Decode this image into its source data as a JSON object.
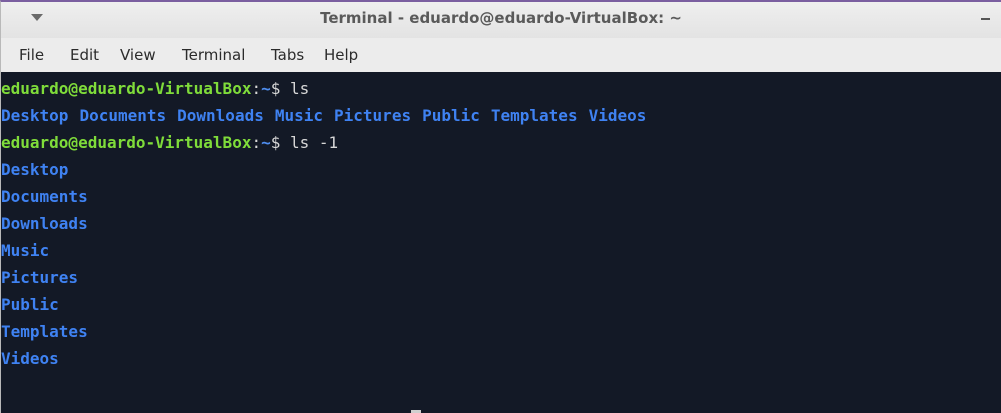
{
  "window": {
    "title": "Terminal - eduardo@eduardo-VirtualBox: ~"
  },
  "menubar": {
    "items": [
      "File",
      "Edit",
      "View",
      "Terminal",
      "Tabs",
      "Help"
    ]
  },
  "terminal": {
    "prompt_user": "eduardo@eduardo-VirtualBox",
    "prompt_sep": ":",
    "prompt_dir": "~",
    "prompt_symbol": "$",
    "command_1": "ls",
    "ls_output": [
      "Desktop",
      "Documents",
      "Downloads",
      "Music",
      "Pictures",
      "Public",
      "Templates",
      "Videos"
    ],
    "command_2": "ls -1",
    "ls1_output": [
      "Desktop",
      "Documents",
      "Downloads",
      "Music",
      "Pictures",
      "Public",
      "Templates",
      "Videos"
    ]
  },
  "colors": {
    "prompt_user": "#7fdc3a",
    "directory": "#3f82f2",
    "terminal_bg": "#131926",
    "titlebar_border": "#7b5fa0"
  },
  "icons": {
    "window_menu": "chevron-down-icon",
    "minimize": "minimize-icon"
  }
}
